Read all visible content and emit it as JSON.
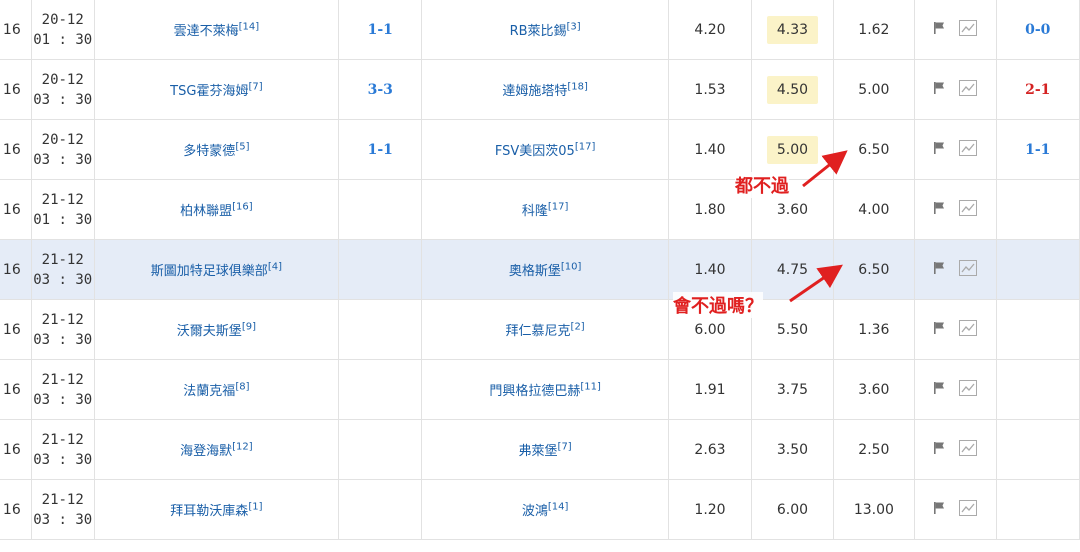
{
  "rows": [
    {
      "round": "16",
      "date": "20-12",
      "time": "01 : 30",
      "home": "雲達不萊梅",
      "home_rank": "[14]",
      "score": "1-1",
      "away": "RB萊比錫",
      "away_rank": "[3]",
      "odd1": "4.20",
      "oddx": "4.33",
      "odd2": "1.62",
      "oddx_hl": true,
      "result": "0-0",
      "result_color": "blue",
      "highlight": false
    },
    {
      "round": "16",
      "date": "20-12",
      "time": "03 : 30",
      "home": "TSG霍芬海姆",
      "home_rank": "[7]",
      "score": "3-3",
      "away": "達姆施塔特",
      "away_rank": "[18]",
      "odd1": "1.53",
      "oddx": "4.50",
      "odd2": "5.00",
      "oddx_hl": true,
      "result": "2-1",
      "result_color": "red",
      "highlight": false
    },
    {
      "round": "16",
      "date": "20-12",
      "time": "03 : 30",
      "home": "多特蒙德",
      "home_rank": "[5]",
      "score": "1-1",
      "away": "FSV美因茨05",
      "away_rank": "[17]",
      "odd1": "1.40",
      "oddx": "5.00",
      "odd2": "6.50",
      "oddx_hl": true,
      "result": "1-1",
      "result_color": "blue",
      "highlight": false
    },
    {
      "round": "16",
      "date": "21-12",
      "time": "01 : 30",
      "home": "柏林聯盟",
      "home_rank": "[16]",
      "score": "",
      "away": "科隆",
      "away_rank": "[17]",
      "odd1": "1.80",
      "oddx": "3.60",
      "odd2": "4.00",
      "oddx_hl": false,
      "result": "",
      "result_color": "blue",
      "highlight": false
    },
    {
      "round": "16",
      "date": "21-12",
      "time": "03 : 30",
      "home": "斯圖加特足球俱樂部",
      "home_rank": "[4]",
      "score": "",
      "away": "奧格斯堡",
      "away_rank": "[10]",
      "odd1": "1.40",
      "oddx": "4.75",
      "odd2": "6.50",
      "oddx_hl": false,
      "result": "",
      "result_color": "blue",
      "highlight": true
    },
    {
      "round": "16",
      "date": "21-12",
      "time": "03 : 30",
      "home": "沃爾夫斯堡",
      "home_rank": "[9]",
      "score": "",
      "away": "拜仁慕尼克",
      "away_rank": "[2]",
      "odd1": "6.00",
      "oddx": "5.50",
      "odd2": "1.36",
      "oddx_hl": false,
      "result": "",
      "result_color": "blue",
      "highlight": false
    },
    {
      "round": "16",
      "date": "21-12",
      "time": "03 : 30",
      "home": "法蘭克福",
      "home_rank": "[8]",
      "score": "",
      "away": "門興格拉德巴赫",
      "away_rank": "[11]",
      "odd1": "1.91",
      "oddx": "3.75",
      "odd2": "3.60",
      "oddx_hl": false,
      "result": "",
      "result_color": "blue",
      "highlight": false
    },
    {
      "round": "16",
      "date": "21-12",
      "time": "03 : 30",
      "home": "海登海默",
      "home_rank": "[12]",
      "score": "",
      "away": "弗萊堡",
      "away_rank": "[7]",
      "odd1": "2.63",
      "oddx": "3.50",
      "odd2": "2.50",
      "oddx_hl": false,
      "result": "",
      "result_color": "blue",
      "highlight": false
    },
    {
      "round": "16",
      "date": "21-12",
      "time": "03 : 30",
      "home": "拜耳勒沃庫森",
      "home_rank": "[1]",
      "score": "",
      "away": "波鴻",
      "away_rank": "[14]",
      "odd1": "1.20",
      "oddx": "6.00",
      "odd2": "13.00",
      "oddx_hl": false,
      "result": "",
      "result_color": "blue",
      "highlight": false
    }
  ],
  "annotations": {
    "a1": "都不過",
    "a2": "會不過嗎？"
  },
  "icons": {
    "flag": "flag-icon",
    "chart": "chart-icon"
  },
  "colors": {
    "link": "#1a5fa8",
    "score_blue": "#2a7ad6",
    "result_red": "#d42222",
    "odds_highlight": "#fbf3c8",
    "row_highlight": "#e5ecf7",
    "annotation": "#e02020"
  }
}
